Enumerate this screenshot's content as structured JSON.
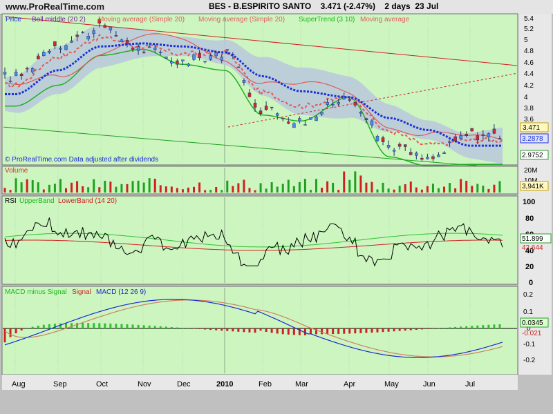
{
  "header": {
    "site": "www.ProRealTime.com",
    "instrument": "BES - B.ESPIRITO SANTO",
    "quote": "3.471 (-2.47%)",
    "period": "2 days",
    "date": "23 Jul"
  },
  "price_panel": {
    "legend": [
      {
        "text": "Price",
        "color": "#1c2ad0"
      },
      {
        "text": "Boll middle (20 2)",
        "color": "#7a1aa8"
      },
      {
        "text": "Moving average (Simple 20)",
        "color": "#e06060"
      },
      {
        "text": "Moving average (Simple 20)",
        "color": "#e06060"
      },
      {
        "text": "SuperTrend (3 10)",
        "color": "#1ab81a"
      },
      {
        "text": "Moving average",
        "color": "#e06060"
      }
    ],
    "source_note": "© ProRealTime.com  Data adjusted after dividends",
    "y_ticks": [
      "5.4",
      "5.2",
      "5",
      "4.8",
      "4.6",
      "4.4",
      "4.2",
      "4",
      "3.8",
      "3.6"
    ],
    "price_tag": "3.471",
    "boll_tag": "3.2878",
    "supertrend_tag": "2.9752"
  },
  "volume_panel": {
    "title": "Volume",
    "y_ticks": [
      "20M",
      "10M"
    ],
    "value_tag": "3,941K"
  },
  "rsi_panel": {
    "title": "RSI",
    "upper_label": "UpperBand",
    "lower_label": "LowerBand (14 20)",
    "y_ticks": [
      "100",
      "80",
      "60",
      "40",
      "20",
      "0"
    ],
    "upper_tag": "51.899",
    "lower_tag": "42.644"
  },
  "macd_panel": {
    "title_hist": "MACD minus Signal",
    "title_signal": "Signal",
    "title_macd": "MACD (12 26 9)",
    "y_ticks": [
      "0.2",
      "0.1",
      "0",
      "-0.1",
      "-0.2"
    ],
    "hist_tag": "0.0345",
    "signal_tag": "-0.021"
  },
  "x_axis": {
    "labels": [
      "Aug",
      "Sep",
      "Oct",
      "Nov",
      "Dec",
      "2010",
      "Feb",
      "Mar",
      "Apr",
      "May",
      "Jun",
      "Jul"
    ]
  },
  "colors": {
    "panel_bg": "#ccf5c0",
    "up_candle": "#4a8ef0",
    "down_candle": "#d02828",
    "boll_band": "#b8c8dc",
    "boll_middle": "#1c30d8",
    "supertrend": "#20b020",
    "ma": "#e05858",
    "trendline": "#d02020"
  },
  "chart_data": [
    {
      "type": "candlestick",
      "title": "BES - B.ESPIRITO SANTO",
      "ylim": [
        3.0,
        5.45
      ],
      "x": [
        "Aug",
        "Sep",
        "Oct",
        "Nov",
        "Dec",
        "2010",
        "Feb",
        "Mar",
        "Apr",
        "May",
        "Jun",
        "Jul"
      ],
      "close": [
        4.45,
        5.0,
        5.25,
        4.9,
        4.7,
        4.85,
        3.9,
        3.7,
        4.1,
        3.3,
        3.05,
        3.471
      ],
      "series": [
        {
          "name": "Boll middle (20 2)",
          "values": [
            4.15,
            4.55,
            4.95,
            5.0,
            4.95,
            4.85,
            4.45,
            4.2,
            4.1,
            3.75,
            3.55,
            3.2878
          ]
        },
        {
          "name": "SuperTrend (3 10)",
          "values": [
            3.95,
            4.3,
            4.8,
            4.9,
            4.65,
            4.55,
            3.8,
            3.7,
            4.1,
            3.1,
            2.95,
            2.9752
          ]
        }
      ],
      "last_value": 3.471
    },
    {
      "type": "bar",
      "title": "Volume",
      "ylim": [
        0,
        22000000
      ],
      "last_value": 3941000
    },
    {
      "type": "line",
      "title": "RSI",
      "ylim": [
        0,
        100
      ],
      "series": [
        {
          "name": "UpperBand",
          "last_value": 51.899
        },
        {
          "name": "LowerBand (14 20)",
          "last_value": 42.644
        }
      ]
    },
    {
      "type": "line",
      "title": "MACD (12 26 9)",
      "ylim": [
        -0.25,
        0.25
      ],
      "series": [
        {
          "name": "MACD minus Signal",
          "last_value": 0.0345
        },
        {
          "name": "Signal",
          "last_value": -0.021
        }
      ]
    }
  ]
}
